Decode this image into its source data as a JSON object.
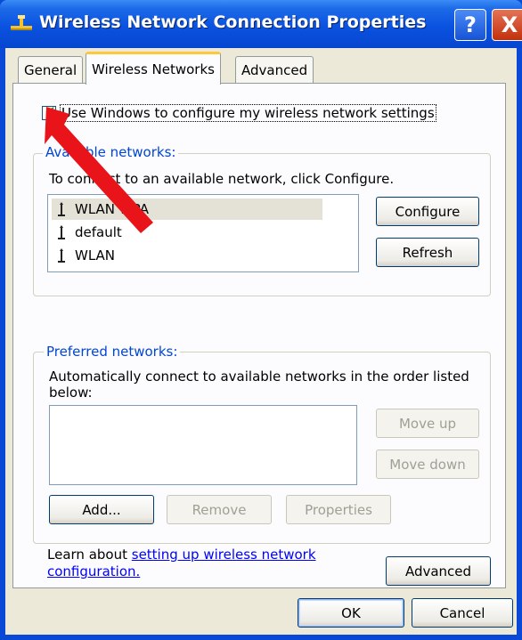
{
  "window": {
    "title": "Wireless Network Connection Properties",
    "help_glyph": "?",
    "close_glyph": "X"
  },
  "tabs": [
    {
      "label": "General",
      "active": false
    },
    {
      "label": "Wireless Networks",
      "active": true
    },
    {
      "label": "Advanced",
      "active": false
    }
  ],
  "use_windows_checkbox": {
    "label": "Use Windows to configure my wireless network settings",
    "checked": true
  },
  "available_networks": {
    "legend": "Available networks:",
    "instruction": "To connect to an available network, click Configure.",
    "networks": [
      "WLAN WPA",
      "default",
      "WLAN"
    ],
    "configure_label": "Configure",
    "refresh_label": "Refresh"
  },
  "preferred_networks": {
    "legend": "Preferred networks:",
    "instruction_line1": "Automatically connect to available networks in the order listed",
    "instruction_line2": "below:",
    "move_up_label": "Move up",
    "move_down_label": "Move down",
    "add_label": "Add...",
    "remove_label": "Remove",
    "properties_label": "Properties"
  },
  "learn": {
    "prefix": "Learn about ",
    "link_part1": "setting up wireless network",
    "link_part2": "configuration.",
    "advanced_label": "Advanced"
  },
  "footer": {
    "ok_label": "OK",
    "cancel_label": "Cancel"
  },
  "colors": {
    "titlebar": "#0a52e0",
    "legend": "#0046d5",
    "annotation_arrow": "#e8141a"
  }
}
